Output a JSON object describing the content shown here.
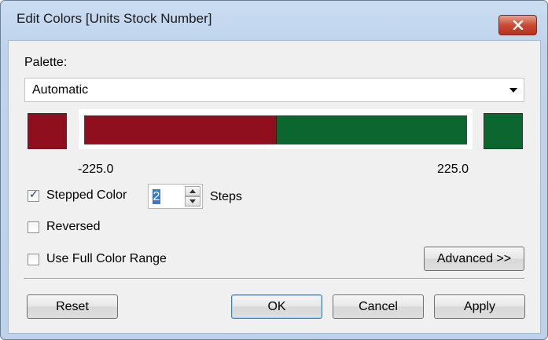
{
  "window": {
    "title": "Edit Colors [Units Stock Number]"
  },
  "palette": {
    "label": "Palette:",
    "selected": "Automatic"
  },
  "ramp": {
    "min_label": "-225.0",
    "max_label": "225.0",
    "negative_color": "#8f0f1f",
    "positive_color": "#0b6630",
    "split_fraction": 0.5
  },
  "options": {
    "stepped_color_label": "Stepped Color",
    "stepped_color_checked": true,
    "steps_value": "2",
    "steps_label": "Steps",
    "reversed_label": "Reversed",
    "reversed_checked": false,
    "full_range_label": "Use Full Color Range",
    "full_range_checked": false
  },
  "buttons": {
    "advanced": "Advanced >>",
    "reset": "Reset",
    "ok": "OK",
    "cancel": "Cancel",
    "apply": "Apply"
  },
  "icons": {
    "close": "close-icon",
    "dropdown": "chevron-down-icon",
    "check": "checkmark-icon"
  }
}
